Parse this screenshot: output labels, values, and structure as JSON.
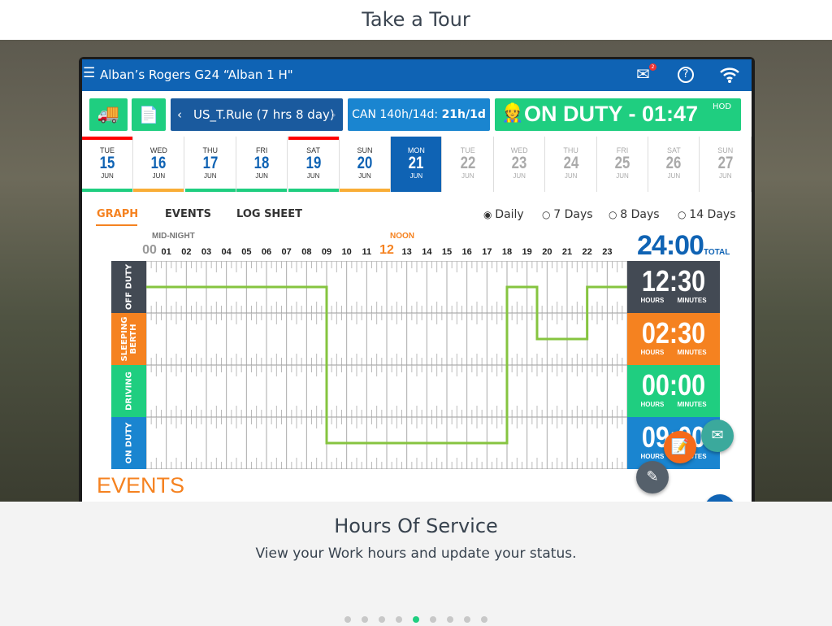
{
  "page_title": "Take a Tour",
  "app": {
    "title": "Alban’s Rogers G24 “Alban 1 H\"",
    "mail_badge": "2",
    "icons": [
      "menu-icon",
      "mail-icon",
      "help-icon",
      "wifi-icon",
      "truck-check-icon",
      "document-certificate-icon",
      "driver-icon"
    ]
  },
  "toolbar": {
    "rule": "US_T.Rule (7 hrs 8 day)",
    "can_prefix": "CAN 140h/14d: ",
    "can_value": "21h/1d",
    "status": "ON DUTY - 01:47",
    "status_sup": "HOD"
  },
  "days": [
    {
      "dow": "TUE",
      "num": "15",
      "mon": "JUN",
      "top": "#ff0000",
      "bottom": "#1fce80"
    },
    {
      "dow": "WED",
      "num": "16",
      "mon": "JUN",
      "top": "",
      "bottom": "#f9ad36"
    },
    {
      "dow": "THU",
      "num": "17",
      "mon": "JUN",
      "top": "",
      "bottom": "#1fce80"
    },
    {
      "dow": "FRI",
      "num": "18",
      "mon": "JUN",
      "top": "",
      "bottom": "#1fce80"
    },
    {
      "dow": "SAT",
      "num": "19",
      "mon": "JUN",
      "top": "#ff0000",
      "bottom": "#1fce80"
    },
    {
      "dow": "SUN",
      "num": "20",
      "mon": "JUN",
      "top": "",
      "bottom": "#f9ad36"
    },
    {
      "dow": "MON",
      "num": "21",
      "mon": "JUN",
      "selected": true
    },
    {
      "dow": "TUE",
      "num": "22",
      "mon": "JUN",
      "future": true
    },
    {
      "dow": "WED",
      "num": "23",
      "mon": "JUN",
      "future": true
    },
    {
      "dow": "THU",
      "num": "24",
      "mon": "JUN",
      "future": true
    },
    {
      "dow": "FRI",
      "num": "25",
      "mon": "JUN",
      "future": true
    },
    {
      "dow": "SAT",
      "num": "26",
      "mon": "JUN",
      "future": true
    },
    {
      "dow": "SUN",
      "num": "27",
      "mon": "JUN",
      "future": true
    }
  ],
  "tabs": [
    "GRAPH",
    "EVENTS",
    "LOG SHEET"
  ],
  "ranges": [
    "Daily",
    "7 Days",
    "8 Days",
    "14 Days"
  ],
  "selected_range": "Daily",
  "graph": {
    "midnight": "MID-NIGHT",
    "noon": "NOON",
    "hours": [
      "00",
      "01",
      "02",
      "03",
      "04",
      "05",
      "06",
      "07",
      "08",
      "09",
      "10",
      "11",
      "12",
      "13",
      "14",
      "15",
      "16",
      "17",
      "18",
      "19",
      "20",
      "21",
      "22",
      "23"
    ],
    "total": "24:00",
    "total_label": "TOTAL",
    "rows": [
      {
        "label": "OFF DUTY",
        "value": "12:30",
        "color": "#434a54"
      },
      {
        "label": "SLEEPING BERTH",
        "value": "02:30",
        "color": "#f58220"
      },
      {
        "label": "DRIVING",
        "value": "00:00",
        "color": "#1fce80"
      },
      {
        "label": "ON DUTY",
        "value": "09:00",
        "color": "#1a85d0"
      }
    ],
    "units": "HOURS MINUTES",
    "line_color": "#86c440",
    "segments": [
      {
        "status": 0,
        "start": 0,
        "end": 9
      },
      {
        "status": 3,
        "start": 9,
        "end": 18
      },
      {
        "status": 0,
        "start": 18,
        "end": 19.5
      },
      {
        "status": 1,
        "start": 19.5,
        "end": 22
      },
      {
        "status": 0,
        "start": 22,
        "end": 24
      }
    ]
  },
  "events_heading": "EVENTS",
  "feature": {
    "title": "Hours Of Service",
    "desc": "View your Work hours and update your status."
  },
  "pagination": {
    "count": 9,
    "active": 4
  }
}
